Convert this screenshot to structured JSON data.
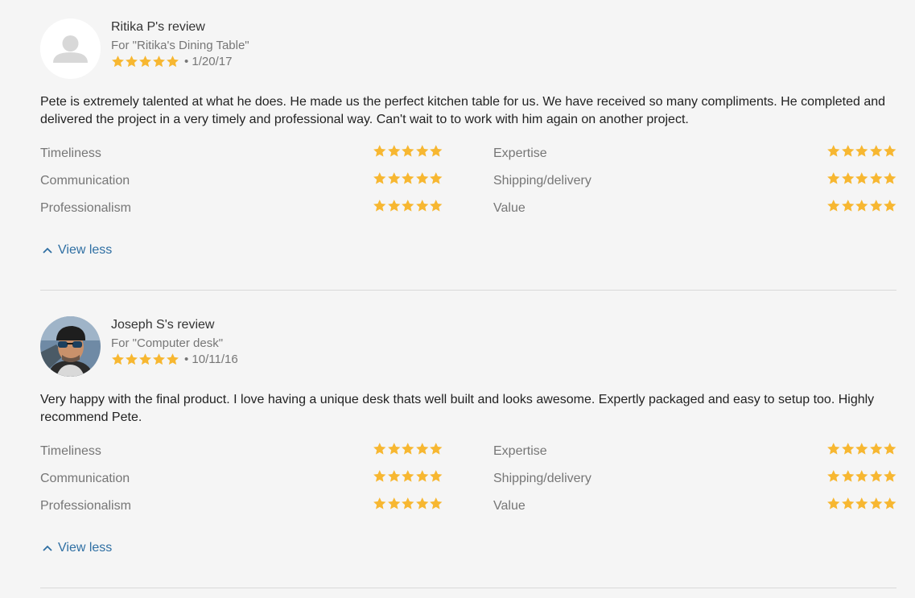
{
  "colors": {
    "star": "#f7b731",
    "link": "#2f6fa3",
    "muted": "#767676"
  },
  "reviews": [
    {
      "reviewer": "Ritika P's review",
      "project": "For \"Ritika's Dining Table\"",
      "rating": 5,
      "date_text": "• 1/20/17",
      "avatar": "default-user-avatar",
      "body": "Pete is extremely talented at what he does. He made us the perfect kitchen table for us. We have received so many compliments. He completed and delivered the project in a very timely and professional way. Can't wait to to work with him again on another project.",
      "criteria": [
        {
          "label": "Timeliness",
          "rating": 5
        },
        {
          "label": "Expertise",
          "rating": 5
        },
        {
          "label": "Communication",
          "rating": 5
        },
        {
          "label": "Shipping/delivery",
          "rating": 5
        },
        {
          "label": "Professionalism",
          "rating": 5
        },
        {
          "label": "Value",
          "rating": 5
        }
      ],
      "toggle_label": "View less"
    },
    {
      "reviewer": "Joseph S's review",
      "project": "For \"Computer desk\"",
      "rating": 5,
      "date_text": "• 10/11/16",
      "avatar": "user-photo-avatar",
      "body": "Very happy with the final product. I love having a unique desk thats well built and looks awesome. Expertly packaged and easy to setup too. Highly recommend Pete.",
      "criteria": [
        {
          "label": "Timeliness",
          "rating": 5
        },
        {
          "label": "Expertise",
          "rating": 5
        },
        {
          "label": "Communication",
          "rating": 5
        },
        {
          "label": "Shipping/delivery",
          "rating": 5
        },
        {
          "label": "Professionalism",
          "rating": 5
        },
        {
          "label": "Value",
          "rating": 5
        }
      ],
      "toggle_label": "View less"
    }
  ]
}
